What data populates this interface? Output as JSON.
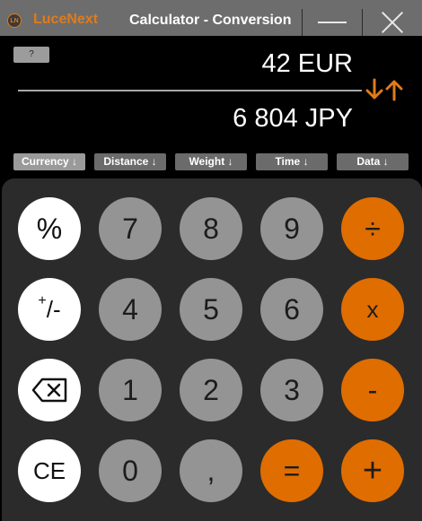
{
  "window": {
    "logo_text": "LN",
    "brand": "LuceNext",
    "title": "Calculator - Conversion"
  },
  "display": {
    "help_label": "?",
    "top_value": "42 EUR",
    "bottom_value": "6 804 JPY"
  },
  "tabs": [
    {
      "label": "Currency ↓",
      "active": true
    },
    {
      "label": "Distance ↓",
      "active": false
    },
    {
      "label": "Weight ↓",
      "active": false
    },
    {
      "label": "Time ↓",
      "active": false
    },
    {
      "label": "Data ↓",
      "active": false
    }
  ],
  "keys": {
    "percent": "%",
    "plusminus_plus": "+",
    "plusminus_rest": "/-",
    "backspace": "⌫",
    "ce": "CE",
    "seven": "7",
    "eight": "8",
    "nine": "9",
    "four": "4",
    "five": "5",
    "six": "6",
    "one": "1",
    "two": "2",
    "three": "3",
    "zero": "0",
    "comma": ",",
    "divide": "÷",
    "multiply": "x",
    "minus": "-",
    "equals": "=",
    "plus": "+"
  },
  "colors": {
    "accent": "#e07b1a",
    "operator_key": "#e06d00",
    "digit_key": "#949494",
    "function_key": "#ffffff",
    "keypad_bg": "#2b2b2b",
    "titlebar_bg": "#6d6d6d"
  },
  "icons": {
    "swap": "down-up-arrows-icon",
    "minimize": "minimize-icon",
    "close": "close-icon",
    "backspace": "backspace-icon"
  }
}
